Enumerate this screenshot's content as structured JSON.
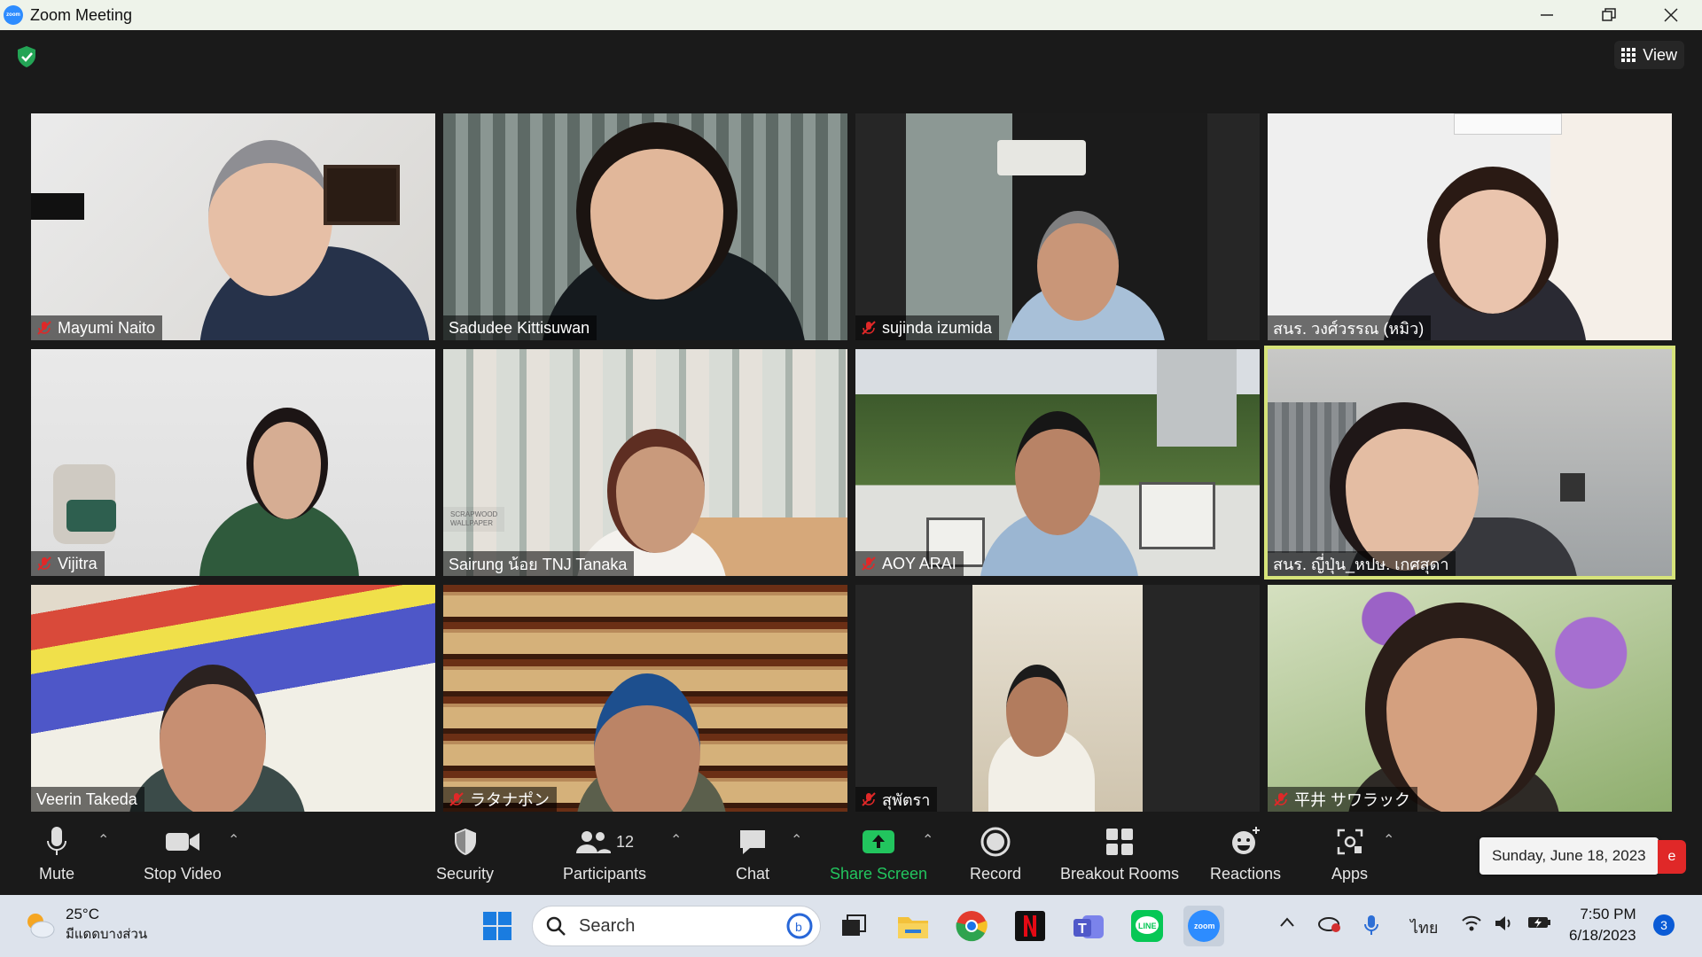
{
  "window": {
    "title": "Zoom Meeting",
    "logo_text": "zoom"
  },
  "meeting": {
    "view_label": "View"
  },
  "participants": [
    {
      "name": "Mayumi Naito",
      "muted": true
    },
    {
      "name": "Sadudee Kittisuwan",
      "muted": false
    },
    {
      "name": "sujinda izumida",
      "muted": true
    },
    {
      "name": "สนร. วงศ์วรรณ (หมิว)",
      "muted": false
    },
    {
      "name": "Vijitra",
      "muted": true
    },
    {
      "name": "Sairung  น้อย TNJ Tanaka",
      "muted": false,
      "bg_text": [
        "SCRAPWOOD",
        "WALLPAPER"
      ]
    },
    {
      "name": "AOY ARAI",
      "muted": true
    },
    {
      "name": "สนร. ญี่ปุ่น_หปษ. เกศสุดา",
      "muted": false,
      "active_speaker": true
    },
    {
      "name": "Veerin Takeda",
      "muted": false
    },
    {
      "name": "ラタナポン",
      "muted": true
    },
    {
      "name": "สุพัตรา",
      "muted": true
    },
    {
      "name": "平井  サワラック",
      "muted": true
    }
  ],
  "toolbar": {
    "mute": "Mute",
    "stop_video": "Stop Video",
    "security": "Security",
    "participants": "Participants",
    "participants_count": "12",
    "chat": "Chat",
    "share_screen": "Share Screen",
    "record": "Record",
    "breakout_rooms": "Breakout Rooms",
    "reactions": "Reactions",
    "apps": "Apps",
    "date_tooltip": "Sunday, June 18, 2023",
    "leave_peek": "e"
  },
  "taskbar": {
    "weather_temp": "25°C",
    "weather_desc": "มีแดดบางส่วน",
    "search_placeholder": "Search",
    "language": "ไทย",
    "time": "7:50 PM",
    "date": "6/18/2023",
    "notifications": "3"
  },
  "colors": {
    "accent_share": "#22c55e",
    "active_speaker_border": "#d6e37a",
    "mute_red": "#e02828",
    "zoom_blue": "#2d8cff"
  }
}
